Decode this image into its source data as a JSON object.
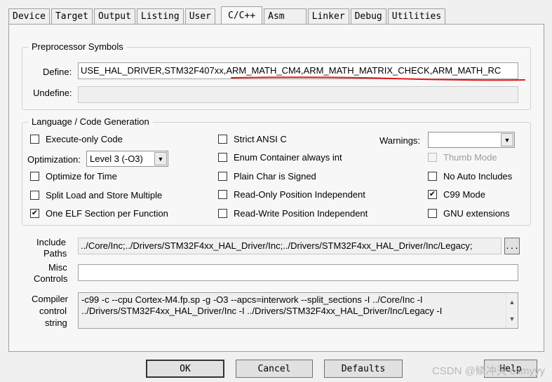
{
  "tabs": [
    {
      "label": "Device"
    },
    {
      "label": "Target"
    },
    {
      "label": "Output"
    },
    {
      "label": "Listing"
    },
    {
      "label": "User"
    },
    {
      "label": "C/C++"
    },
    {
      "label": "Asm"
    },
    {
      "label": "Linker"
    },
    {
      "label": "Debug"
    },
    {
      "label": "Utilities"
    }
  ],
  "preprocessor": {
    "legend": "Preprocessor Symbols",
    "define_label": "Define:",
    "define_value": "USE_HAL_DRIVER,STM32F407xx,ARM_MATH_CM4,ARM_MATH_MATRIX_CHECK,ARM_MATH_RC",
    "undefine_label": "Undefine:",
    "undefine_value": ""
  },
  "language": {
    "legend": "Language / Code Generation",
    "execute_only": "Execute-only Code",
    "optimization_label": "Optimization:",
    "optimization_value": "Level 3 (-O3)",
    "optimize_time": "Optimize for Time",
    "split_load": "Split Load and Store Multiple",
    "one_elf": "One ELF Section per Function",
    "strict_ansi": "Strict ANSI C",
    "enum_container": "Enum Container always int",
    "plain_char": "Plain Char is Signed",
    "ro_pi": "Read-Only Position Independent",
    "rw_pi": "Read-Write Position Independent",
    "warnings_label": "Warnings:",
    "warnings_value": "",
    "thumb_mode": "Thumb Mode",
    "no_auto_includes": "No Auto Includes",
    "c99_mode": "C99 Mode",
    "gnu_ext": "GNU extensions"
  },
  "include": {
    "label_line1": "Include",
    "label_line2": "Paths",
    "value": "../Core/Inc;../Drivers/STM32F4xx_HAL_Driver/Inc;../Drivers/STM32F4xx_HAL_Driver/Inc/Legacy;",
    "browse_label": "..."
  },
  "misc": {
    "label_line1": "Misc",
    "label_line2": "Controls",
    "value": ""
  },
  "compiler": {
    "label_line1": "Compiler",
    "label_line2": "control",
    "label_line3": "string",
    "line1": "-c99 -c --cpu Cortex-M4.fp.sp -g -O3 --apcs=interwork --split_sections -I ../Core/Inc -I",
    "line2": "../Drivers/STM32F4xx_HAL_Driver/Inc -I ../Drivers/STM32F4xx_HAL_Driver/Inc/Legacy -I"
  },
  "buttons": {
    "ok": "OK",
    "cancel": "Cancel",
    "defaults": "Defaults",
    "help": "Help"
  },
  "watermark": "CSDN @鳞冲天 csmyyy"
}
